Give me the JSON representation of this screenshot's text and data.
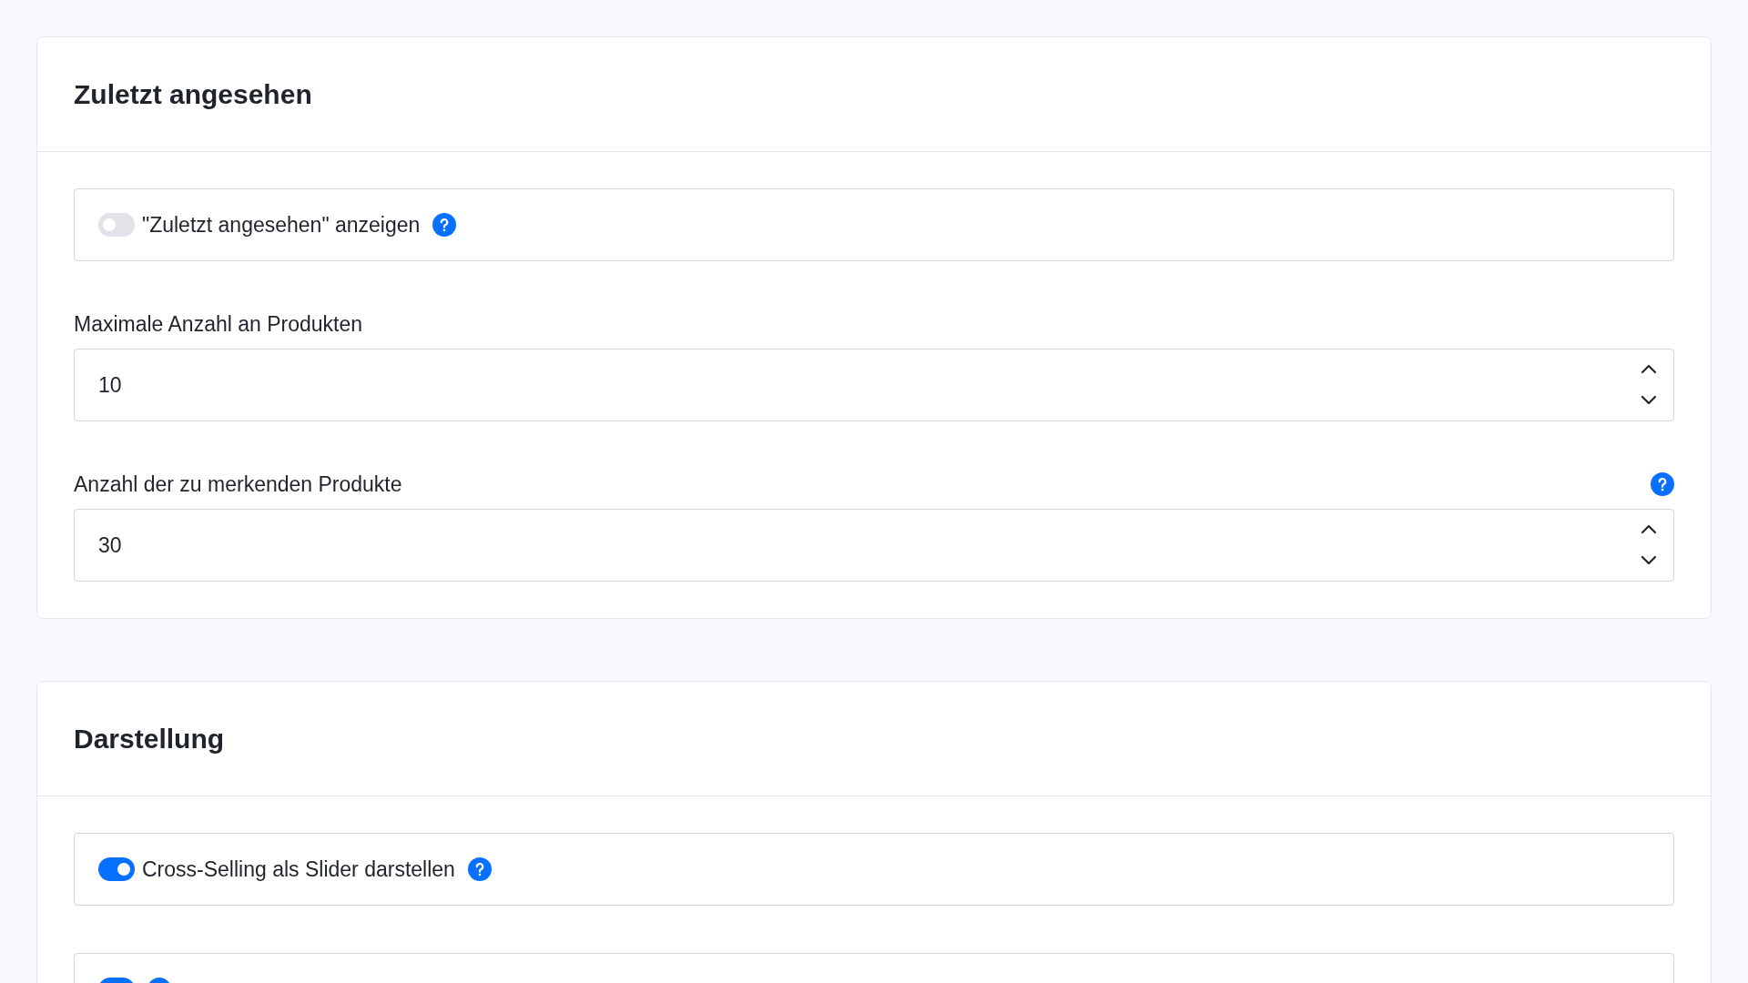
{
  "sections": [
    {
      "title": "Zuletzt angesehen",
      "fields": [
        {
          "kind": "toggle",
          "label": "\"Zuletzt angesehen\" anzeigen",
          "on": false,
          "help": true
        },
        {
          "kind": "number",
          "label": "Maximale Anzahl an Produkten",
          "value": "10",
          "help": false
        },
        {
          "kind": "number",
          "label": "Anzahl der zu merkenden Produkte",
          "value": "30",
          "help": true
        }
      ]
    },
    {
      "title": "Darstellung",
      "fields": [
        {
          "kind": "toggle",
          "label": "Cross-Selling als Slider darstellen",
          "on": true,
          "help": true
        },
        {
          "kind": "toggle",
          "on": true,
          "help": true
        }
      ]
    }
  ]
}
